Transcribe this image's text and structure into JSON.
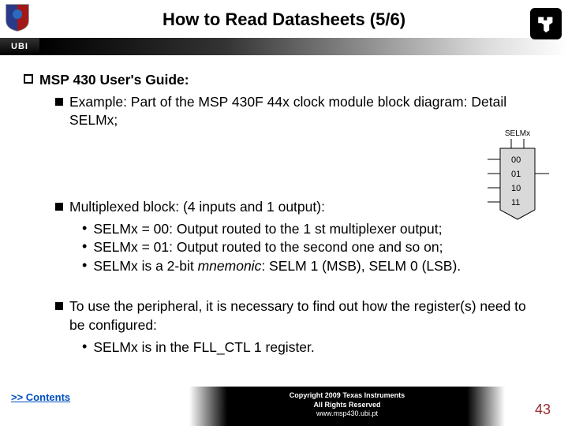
{
  "header": {
    "title": "How to Read Datasheets (5/6)",
    "ubi_label": "UBI"
  },
  "content": {
    "heading": "MSP 430 User's Guide:",
    "example_line": "Example: Part of the MSP 430F 44x clock module block diagram: Detail SELMx;",
    "mux_intro": "Multiplexed block: (4 inputs and 1 output):",
    "mux_b1": "SELMx = 00: Output routed to the 1 st multiplexer output;",
    "mux_b2": "SELMx = 01: Output routed to the second one and so on;",
    "mux_b3_pre": "SELMx is a 2-bit ",
    "mux_b3_ital": "mnemonic",
    "mux_b3_post": ": SELM 1 (MSB), SELM 0 (LSB).",
    "use_line": "To use the peripheral, it is necessary to find out how the register(s) need to be configured:",
    "use_b1": "SELMx is in the FLL_CTL 1 register."
  },
  "figure": {
    "label": "SELMx",
    "opts": [
      "00",
      "01",
      "10",
      "11"
    ]
  },
  "footer": {
    "contents_link": ">> Contents",
    "copyright": "Copyright  2009 Texas Instruments",
    "rights": "All Rights Reserved",
    "url": "www.msp430.ubi.pt",
    "page": "43"
  }
}
